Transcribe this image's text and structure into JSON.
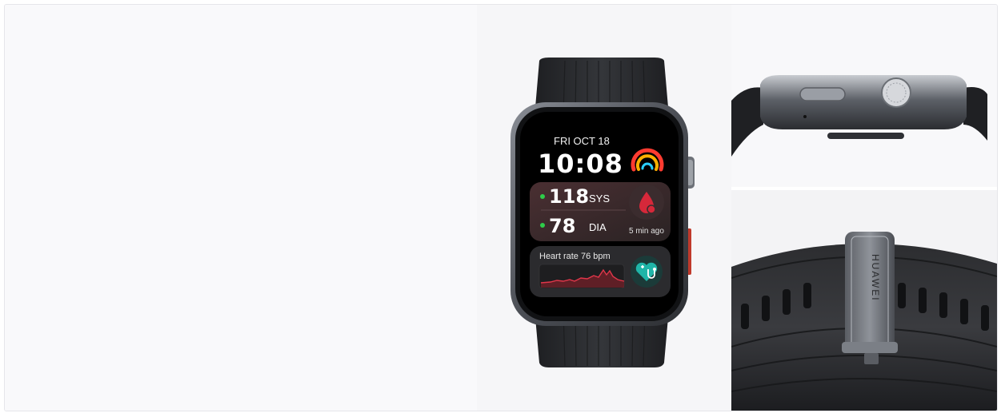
{
  "watch_face": {
    "date": "FRI OCT 18",
    "time": "10:08",
    "systolic_value": "118",
    "systolic_unit": "SYS",
    "diastolic_value": "78",
    "diastolic_unit": "DIA",
    "measured_ago": "5 min ago",
    "heart_rate_label": "Heart rate 76 bpm"
  },
  "strap": {
    "brand_engraving": "HUAWEI"
  },
  "colors": {
    "background": "#f8f8fa",
    "strap": "#2a2b2e",
    "case": "#5b5f66",
    "screen": "#000000",
    "card": "#3a2a2c",
    "red_accent": "#d6283a",
    "green_dot": "#2ecc4a",
    "teal_icon": "#1fb5a8"
  }
}
